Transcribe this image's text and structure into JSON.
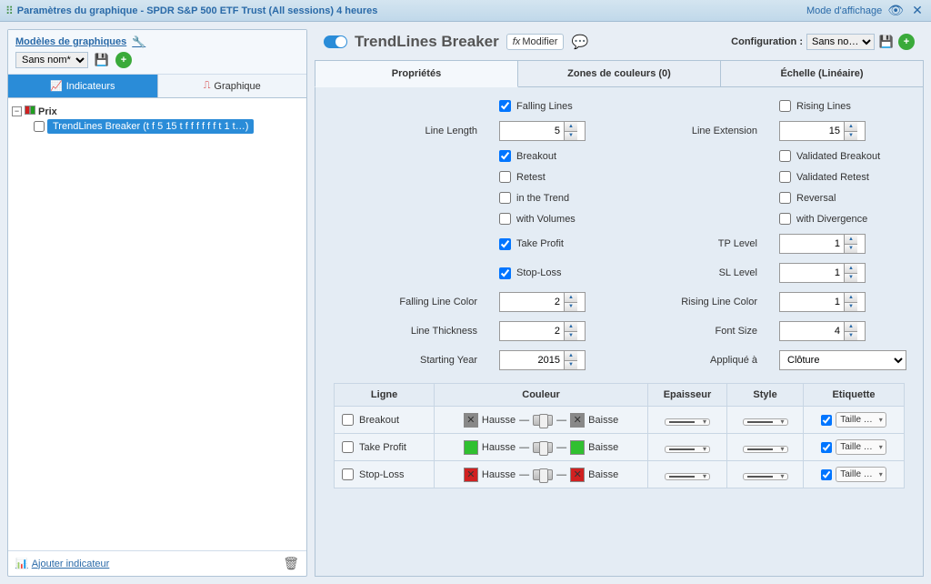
{
  "titlebar": {
    "text": "Paramètres du graphique - SPDR S&P 500 ETF Trust (All sessions) 4 heures",
    "mode": "Mode d'affichage"
  },
  "sidebar": {
    "title": "Modèles de graphiques",
    "template_select": "Sans nom*",
    "tabs": {
      "indicators": "Indicateurs",
      "chart": "Graphique"
    },
    "tree": {
      "root": "Prix",
      "child": "TrendLines Breaker (t f 5 15 t f f f f f f t 1 t…)"
    },
    "footer": "Ajouter indicateur"
  },
  "header": {
    "name": "TrendLines Breaker",
    "modify": "Modifier",
    "config_label": "Configuration :",
    "config_value": "Sans no…"
  },
  "tabs": {
    "props": "Propriétés",
    "zones": "Zones de couleurs (0)",
    "scale": "Échelle (Linéaire)"
  },
  "form": {
    "falling_lines": "Falling Lines",
    "rising_lines": "Rising Lines",
    "line_length": "Line Length",
    "line_length_val": "5",
    "line_extension": "Line Extension",
    "line_extension_val": "15",
    "breakout": "Breakout",
    "validated_breakout": "Validated Breakout",
    "retest": "Retest",
    "validated_retest": "Validated Retest",
    "in_trend": "in the Trend",
    "reversal": "Reversal",
    "with_volumes": "with Volumes",
    "with_divergence": "with Divergence",
    "take_profit": "Take Profit",
    "tp_level": "TP Level",
    "tp_level_val": "1",
    "stop_loss": "Stop-Loss",
    "sl_level": "SL Level",
    "sl_level_val": "1",
    "falling_color": "Falling Line Color",
    "falling_color_val": "2",
    "rising_color": "Rising Line Color",
    "rising_color_val": "1",
    "thickness": "Line Thickness",
    "thickness_val": "2",
    "font_size": "Font Size",
    "font_size_val": "4",
    "start_year": "Starting Year",
    "start_year_val": "2015",
    "applied_to": "Appliqué à",
    "applied_to_val": "Clôture"
  },
  "style_table": {
    "headers": {
      "line": "Ligne",
      "color": "Couleur",
      "thickness": "Epaisseur",
      "style": "Style",
      "label": "Etiquette"
    },
    "hausse": "Hausse",
    "baisse": "Baisse",
    "taille": "Taille …",
    "rows": {
      "breakout": "Breakout",
      "take_profit": "Take Profit",
      "stop_loss": "Stop-Loss"
    },
    "colors": {
      "breakout": "#888888",
      "take_profit": "#30c030",
      "stop_loss": "#d02020"
    }
  }
}
